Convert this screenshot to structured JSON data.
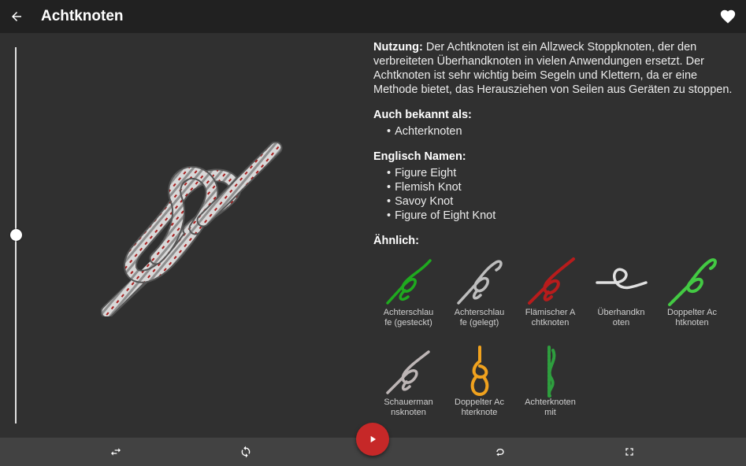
{
  "appbar": {
    "title": "Achtknoten",
    "back_icon": "arrow-back-icon",
    "favorite_icon": "heart-icon"
  },
  "slider": {
    "position": 0.5
  },
  "info": {
    "usage_label": "Nutzung:",
    "usage_text": " Der Achtknoten ist ein Allzweck Stoppknoten, der den verbreiteten Überhandknoten in vielen Anwendungen ersetzt. Der Achtknoten ist sehr wichtig beim Segeln und Klettern, da er eine Methode bietet, das Herausziehen von Seilen aus Geräten zu stoppen.",
    "aka_heading": "Auch bekannt als:",
    "aka": [
      "Achterknoten"
    ],
    "english_heading": "Englisch Namen:",
    "english": [
      "Figure Eight",
      "Flemish Knot",
      "Savoy Knot",
      "Figure of Eight Knot"
    ],
    "similar_heading": "Ähnlich:"
  },
  "similar": [
    {
      "label": "Achterschlaufe (gesteckt)",
      "color": "#1faa1f"
    },
    {
      "label": "Achterschlaufe (gelegt)",
      "color": "#bdbdbd"
    },
    {
      "label": "Flämischer Achtknoten",
      "color": "#b71c1c"
    },
    {
      "label": "Überhandknoten",
      "color": "#e0e0e0"
    },
    {
      "label": "Doppelter Achtknoten",
      "color": "#43c943"
    },
    {
      "label": "Schauermannsknoten",
      "color": "#bdb5b5"
    },
    {
      "label": "Doppelter Achterknote",
      "color": "#f0a21e"
    },
    {
      "label": "Achterknoten mit",
      "color": "#2e9e3e"
    }
  ],
  "bottombar": {
    "icons": [
      "swap-horiz-icon",
      "sync-icon",
      "loop-icon",
      "fullscreen-icon"
    ],
    "play_icon": "play-icon"
  },
  "colors": {
    "accent": "#c62828",
    "appbar": "#212121",
    "background": "#303030",
    "bottombar": "#424242"
  }
}
